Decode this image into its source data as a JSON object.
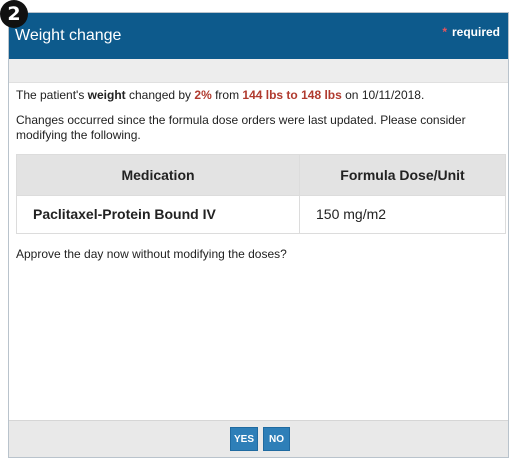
{
  "step_badge": "2",
  "dialog": {
    "title": "Weight change",
    "required_star": "*",
    "required_label": "required"
  },
  "message": {
    "part1": "The patient's ",
    "weight_word": "weight",
    "part2": " changed by ",
    "percent": "2%",
    "part3": " from ",
    "weight_range": "144 lbs to 148 lbs",
    "part4": " on 10/11/2018.",
    "changes_note": "Changes occurred since the formula dose orders were last updated. Please consider modifying the following."
  },
  "table": {
    "headers": [
      "Medication",
      "Formula Dose/Unit"
    ],
    "rows": [
      {
        "medication": "Paclitaxel-Protein Bound IV",
        "dose": "150 mg/m2"
      }
    ]
  },
  "approve_question": "Approve the day now without modifying the doses?",
  "buttons": {
    "yes": "YES",
    "no": "NO"
  },
  "colors": {
    "header_bg": "#0d5a8c",
    "highlight": "#b03a2e",
    "button_bg": "#2e7fb8",
    "required_star": "#e8545d"
  }
}
